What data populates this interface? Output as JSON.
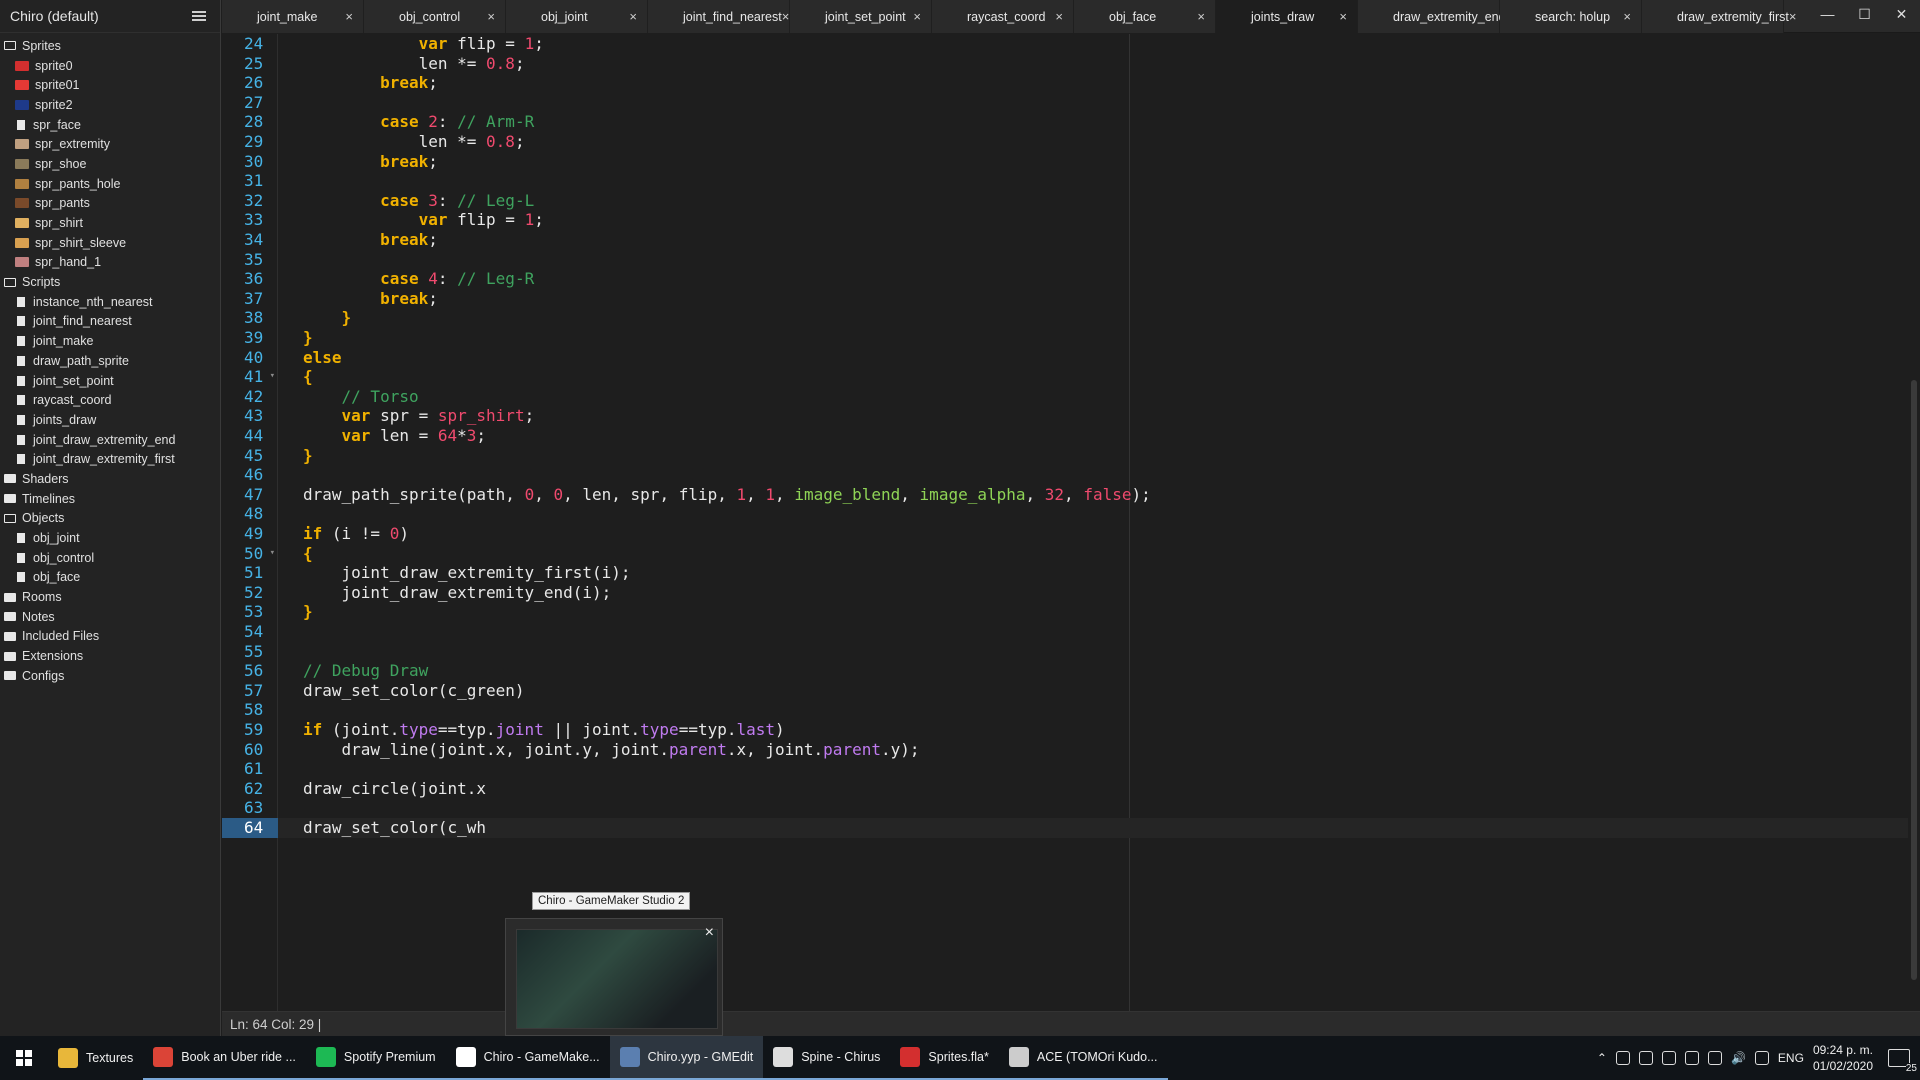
{
  "sidebar": {
    "title": "Chiro (default)",
    "tree": [
      {
        "type": "folder",
        "label": "Sprites",
        "open": true
      },
      {
        "type": "item",
        "label": "sprite0",
        "thumb": "#d32f2f"
      },
      {
        "type": "item",
        "label": "sprite01",
        "thumb": "#e53935"
      },
      {
        "type": "item",
        "label": "sprite2",
        "thumb": "#1e3a8a"
      },
      {
        "type": "item",
        "label": "spr_face",
        "thumb": "doc"
      },
      {
        "type": "item",
        "label": "spr_extremity",
        "thumb": "#c0a080"
      },
      {
        "type": "item",
        "label": "spr_shoe",
        "thumb": "#8a7a5a"
      },
      {
        "type": "item",
        "label": "spr_pants_hole",
        "thumb": "#b08040"
      },
      {
        "type": "item",
        "label": "spr_pants",
        "thumb": "#7a4a2a"
      },
      {
        "type": "item",
        "label": "spr_shirt",
        "thumb": "#e0b060"
      },
      {
        "type": "item",
        "label": "spr_shirt_sleeve",
        "thumb": "#d8a050"
      },
      {
        "type": "item",
        "label": "spr_hand_1",
        "thumb": "#c08080"
      },
      {
        "type": "folder",
        "label": "Scripts",
        "open": true
      },
      {
        "type": "item",
        "label": "instance_nth_nearest",
        "thumb": "doc"
      },
      {
        "type": "item",
        "label": "joint_find_nearest",
        "thumb": "doc"
      },
      {
        "type": "item",
        "label": "joint_make",
        "thumb": "doc"
      },
      {
        "type": "item",
        "label": "draw_path_sprite",
        "thumb": "doc"
      },
      {
        "type": "item",
        "label": "joint_set_point",
        "thumb": "doc"
      },
      {
        "type": "item",
        "label": "raycast_coord",
        "thumb": "doc"
      },
      {
        "type": "item",
        "label": "joints_draw",
        "thumb": "doc"
      },
      {
        "type": "item",
        "label": "joint_draw_extremity_end",
        "thumb": "doc"
      },
      {
        "type": "item",
        "label": "joint_draw_extremity_first",
        "thumb": "doc"
      },
      {
        "type": "folder",
        "label": "Shaders",
        "open": false
      },
      {
        "type": "folder",
        "label": "Timelines",
        "open": false
      },
      {
        "type": "folder",
        "label": "Objects",
        "open": true
      },
      {
        "type": "item",
        "label": "obj_joint",
        "thumb": "doc"
      },
      {
        "type": "item",
        "label": "obj_control",
        "thumb": "doc"
      },
      {
        "type": "item",
        "label": "obj_face",
        "thumb": "doc"
      },
      {
        "type": "folder",
        "label": "Rooms",
        "open": false
      },
      {
        "type": "folder",
        "label": "Notes",
        "open": false
      },
      {
        "type": "folder",
        "label": "Included Files",
        "open": false
      },
      {
        "type": "folder",
        "label": "Extensions",
        "open": false
      },
      {
        "type": "folder",
        "label": "Configs",
        "open": false
      }
    ]
  },
  "tabs": [
    {
      "label": "joint_make",
      "active": false
    },
    {
      "label": "obj_control",
      "active": false
    },
    {
      "label": "obj_joint",
      "active": false
    },
    {
      "label": "joint_find_nearest",
      "active": false
    },
    {
      "label": "joint_set_point",
      "active": false
    },
    {
      "label": "raycast_coord",
      "active": false
    },
    {
      "label": "obj_face",
      "active": false
    },
    {
      "label": "joints_draw",
      "active": true
    },
    {
      "label": "draw_extremity_end",
      "active": false
    },
    {
      "label": "search: holup",
      "active": false
    },
    {
      "label": "draw_extremity_first",
      "active": false
    }
  ],
  "tab_close_glyph": "×",
  "editor": {
    "current_line": "64",
    "fold_lines": [
      "41",
      "50"
    ],
    "lines": [
      {
        "n": "24",
        "code": [
          {
            "t": "            "
          },
          {
            "t": "var",
            "c": "k"
          },
          {
            "t": " flip = "
          },
          {
            "t": "1",
            "c": "n"
          },
          {
            "t": ";"
          }
        ]
      },
      {
        "n": "25",
        "code": [
          {
            "t": "            len *= "
          },
          {
            "t": "0.8",
            "c": "n"
          },
          {
            "t": ";"
          }
        ]
      },
      {
        "n": "26",
        "code": [
          {
            "t": "        "
          },
          {
            "t": "break",
            "c": "k"
          },
          {
            "t": ";"
          }
        ]
      },
      {
        "n": "27",
        "code": []
      },
      {
        "n": "28",
        "code": [
          {
            "t": "        "
          },
          {
            "t": "case",
            "c": "k"
          },
          {
            "t": " "
          },
          {
            "t": "2",
            "c": "n"
          },
          {
            "t": ": "
          },
          {
            "t": "// Arm-R",
            "c": "c"
          }
        ]
      },
      {
        "n": "29",
        "code": [
          {
            "t": "            len *= "
          },
          {
            "t": "0.8",
            "c": "n"
          },
          {
            "t": ";"
          }
        ]
      },
      {
        "n": "30",
        "code": [
          {
            "t": "        "
          },
          {
            "t": "break",
            "c": "k"
          },
          {
            "t": ";"
          }
        ]
      },
      {
        "n": "31",
        "code": []
      },
      {
        "n": "32",
        "code": [
          {
            "t": "        "
          },
          {
            "t": "case",
            "c": "k"
          },
          {
            "t": " "
          },
          {
            "t": "3",
            "c": "n"
          },
          {
            "t": ": "
          },
          {
            "t": "// Leg-L",
            "c": "c"
          }
        ]
      },
      {
        "n": "33",
        "code": [
          {
            "t": "            "
          },
          {
            "t": "var",
            "c": "k"
          },
          {
            "t": " flip = "
          },
          {
            "t": "1",
            "c": "n"
          },
          {
            "t": ";"
          }
        ]
      },
      {
        "n": "34",
        "code": [
          {
            "t": "        "
          },
          {
            "t": "break",
            "c": "k"
          },
          {
            "t": ";"
          }
        ]
      },
      {
        "n": "35",
        "code": []
      },
      {
        "n": "36",
        "code": [
          {
            "t": "        "
          },
          {
            "t": "case",
            "c": "k"
          },
          {
            "t": " "
          },
          {
            "t": "4",
            "c": "n"
          },
          {
            "t": ": "
          },
          {
            "t": "// Leg-R",
            "c": "c"
          }
        ]
      },
      {
        "n": "37",
        "code": [
          {
            "t": "        "
          },
          {
            "t": "break",
            "c": "k"
          },
          {
            "t": ";"
          }
        ]
      },
      {
        "n": "38",
        "code": [
          {
            "t": "    "
          },
          {
            "t": "}",
            "c": "k"
          }
        ]
      },
      {
        "n": "39",
        "code": [
          {
            "t": "}",
            "c": "k"
          }
        ]
      },
      {
        "n": "40",
        "code": [
          {
            "t": "else",
            "c": "k"
          }
        ]
      },
      {
        "n": "41",
        "code": [
          {
            "t": "{",
            "c": "k"
          }
        ]
      },
      {
        "n": "42",
        "code": [
          {
            "t": "    "
          },
          {
            "t": "// Torso",
            "c": "c"
          }
        ]
      },
      {
        "n": "43",
        "code": [
          {
            "t": "    "
          },
          {
            "t": "var",
            "c": "k"
          },
          {
            "t": " spr = "
          },
          {
            "t": "spr_shirt",
            "c": "v"
          },
          {
            "t": ";"
          }
        ]
      },
      {
        "n": "44",
        "code": [
          {
            "t": "    "
          },
          {
            "t": "var",
            "c": "k"
          },
          {
            "t": " len = "
          },
          {
            "t": "64",
            "c": "n"
          },
          {
            "t": "*"
          },
          {
            "t": "3",
            "c": "n"
          },
          {
            "t": ";"
          }
        ]
      },
      {
        "n": "45",
        "code": [
          {
            "t": "}",
            "c": "k"
          }
        ]
      },
      {
        "n": "46",
        "code": []
      },
      {
        "n": "47",
        "code": [
          {
            "t": "draw_path_sprite(path, "
          },
          {
            "t": "0",
            "c": "n"
          },
          {
            "t": ", "
          },
          {
            "t": "0",
            "c": "n"
          },
          {
            "t": ", len, spr, flip, "
          },
          {
            "t": "1",
            "c": "n"
          },
          {
            "t": ", "
          },
          {
            "t": "1",
            "c": "n"
          },
          {
            "t": ", "
          },
          {
            "t": "image_blend",
            "c": "g"
          },
          {
            "t": ", "
          },
          {
            "t": "image_alpha",
            "c": "g"
          },
          {
            "t": ", "
          },
          {
            "t": "32",
            "c": "n"
          },
          {
            "t": ", "
          },
          {
            "t": "false",
            "c": "n"
          },
          {
            "t": ");"
          }
        ]
      },
      {
        "n": "48",
        "code": []
      },
      {
        "n": "49",
        "code": [
          {
            "t": "if",
            "c": "k"
          },
          {
            "t": " (i != "
          },
          {
            "t": "0",
            "c": "n"
          },
          {
            "t": ")"
          }
        ]
      },
      {
        "n": "50",
        "code": [
          {
            "t": "{",
            "c": "k"
          }
        ]
      },
      {
        "n": "51",
        "code": [
          {
            "t": "    joint_draw_extremity_first(i);"
          }
        ]
      },
      {
        "n": "52",
        "code": [
          {
            "t": "    joint_draw_extremity_end(i);"
          }
        ]
      },
      {
        "n": "53",
        "code": [
          {
            "t": "}",
            "c": "k"
          }
        ]
      },
      {
        "n": "54",
        "code": []
      },
      {
        "n": "55",
        "code": []
      },
      {
        "n": "56",
        "code": [
          {
            "t": "// Debug Draw",
            "c": "c"
          }
        ]
      },
      {
        "n": "57",
        "code": [
          {
            "t": "draw_set_color(c_green)"
          }
        ]
      },
      {
        "n": "58",
        "code": []
      },
      {
        "n": "59",
        "code": [
          {
            "t": "if",
            "c": "k"
          },
          {
            "t": " (joint."
          },
          {
            "t": "type",
            "c": "p"
          },
          {
            "t": "==typ."
          },
          {
            "t": "joint",
            "c": "p"
          },
          {
            "t": " || joint."
          },
          {
            "t": "type",
            "c": "p"
          },
          {
            "t": "==typ."
          },
          {
            "t": "last",
            "c": "p"
          },
          {
            "t": ")"
          }
        ]
      },
      {
        "n": "60",
        "code": [
          {
            "t": "    draw_line(joint.x, joint.y, joint."
          },
          {
            "t": "parent",
            "c": "p"
          },
          {
            "t": ".x, joint."
          },
          {
            "t": "parent",
            "c": "p"
          },
          {
            "t": ".y);"
          }
        ]
      },
      {
        "n": "61",
        "code": []
      },
      {
        "n": "62",
        "code": [
          {
            "t": "draw_circle(joint.x"
          }
        ]
      },
      {
        "n": "63",
        "code": []
      },
      {
        "n": "64",
        "code": [
          {
            "t": "draw_set_color(c_wh"
          }
        ]
      }
    ]
  },
  "status": "Ln:   64 Col:   29 |",
  "tooltip": "Chiro - GameMaker Studio 2",
  "preview_close": "×",
  "taskbar": {
    "items": [
      {
        "label": "Textures",
        "icon": "#e8b73a",
        "state": ""
      },
      {
        "label": "Book an Uber ride ...",
        "icon": "#db4437",
        "state": "open"
      },
      {
        "label": "Spotify Premium",
        "icon": "#1db954",
        "state": "open"
      },
      {
        "label": "Chiro - GameMake...",
        "icon": "#ffffff",
        "state": "open"
      },
      {
        "label": "Chiro.yyp - GMEdit",
        "icon": "#5b7fb0",
        "state": "active"
      },
      {
        "label": "Spine - Chirus",
        "icon": "#dddddd",
        "state": "open"
      },
      {
        "label": "Sprites.fla*",
        "icon": "#d32f2f",
        "state": "open"
      },
      {
        "label": "ACE (TOMOri Kudo...",
        "icon": "#cccccc",
        "state": "open"
      }
    ],
    "tray": {
      "lang": "ENG",
      "time": "09:24 p. m.",
      "date": "01/02/2020",
      "notif": "25"
    }
  }
}
